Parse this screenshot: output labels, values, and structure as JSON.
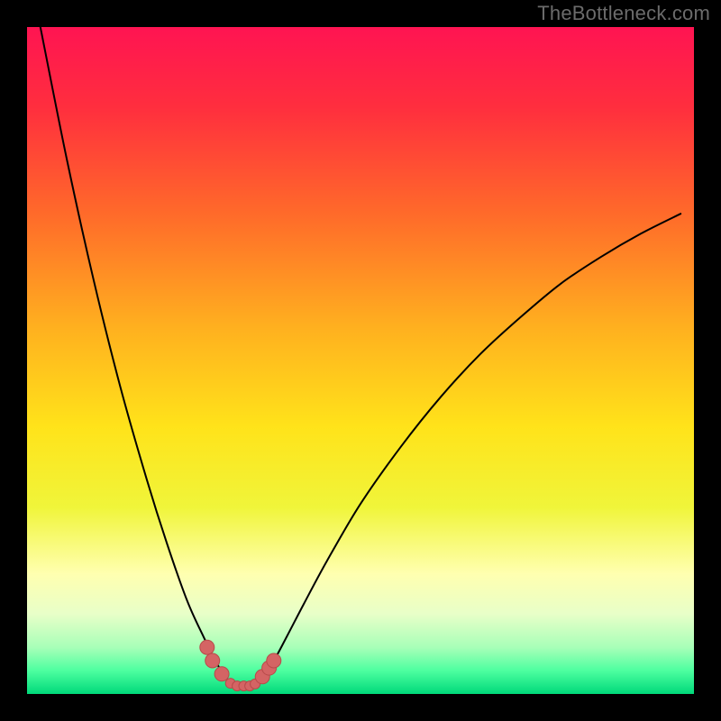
{
  "watermark": "TheBottleneck.com",
  "chart_data": {
    "type": "line",
    "title": "",
    "xlabel": "",
    "ylabel": "",
    "xlim": [
      0,
      100
    ],
    "ylim": [
      0,
      100
    ],
    "background_gradient": {
      "stops": [
        {
          "offset": 0.0,
          "color": "#ff1452"
        },
        {
          "offset": 0.12,
          "color": "#ff2e3e"
        },
        {
          "offset": 0.28,
          "color": "#ff6a2a"
        },
        {
          "offset": 0.45,
          "color": "#ffb01f"
        },
        {
          "offset": 0.6,
          "color": "#ffe31a"
        },
        {
          "offset": 0.72,
          "color": "#f0f53a"
        },
        {
          "offset": 0.82,
          "color": "#ffffb0"
        },
        {
          "offset": 0.88,
          "color": "#e8ffc8"
        },
        {
          "offset": 0.93,
          "color": "#a8ffb8"
        },
        {
          "offset": 0.965,
          "color": "#4dffa0"
        },
        {
          "offset": 1.0,
          "color": "#00d97a"
        }
      ]
    },
    "series": [
      {
        "name": "bottleneck-curve",
        "stroke": "#000000",
        "stroke_width": 2,
        "x": [
          2.0,
          6.0,
          10.0,
          14.0,
          18.0,
          21.0,
          24.0,
          26.5,
          28.5,
          30.2,
          31.0,
          32.0,
          33.5,
          35.0,
          37.0,
          39.0,
          41.5,
          45.0,
          50.0,
          56.0,
          62.0,
          68.0,
          74.0,
          80.0,
          86.0,
          92.0,
          98.0
        ],
        "y": [
          100.0,
          80.0,
          62.0,
          46.0,
          32.0,
          22.5,
          14.0,
          8.5,
          4.5,
          2.0,
          1.2,
          1.0,
          1.2,
          2.2,
          5.0,
          8.7,
          13.5,
          20.0,
          28.5,
          37.0,
          44.5,
          51.0,
          56.5,
          61.5,
          65.5,
          69.0,
          72.0
        ]
      }
    ],
    "markers": {
      "name": "data-points",
      "fill": "#d46464",
      "stroke": "#b84a4a",
      "radius_large": 8,
      "radius_small": 5.5,
      "points": [
        {
          "x": 27.0,
          "y": 7.0,
          "r": "large"
        },
        {
          "x": 27.8,
          "y": 5.0,
          "r": "large"
        },
        {
          "x": 29.2,
          "y": 3.0,
          "r": "large"
        },
        {
          "x": 30.5,
          "y": 1.6,
          "r": "small"
        },
        {
          "x": 31.5,
          "y": 1.2,
          "r": "small"
        },
        {
          "x": 32.5,
          "y": 1.2,
          "r": "small"
        },
        {
          "x": 33.4,
          "y": 1.2,
          "r": "small"
        },
        {
          "x": 34.2,
          "y": 1.5,
          "r": "small"
        },
        {
          "x": 35.3,
          "y": 2.6,
          "r": "large"
        },
        {
          "x": 36.3,
          "y": 3.9,
          "r": "large"
        },
        {
          "x": 37.0,
          "y": 5.0,
          "r": "large"
        }
      ]
    }
  }
}
